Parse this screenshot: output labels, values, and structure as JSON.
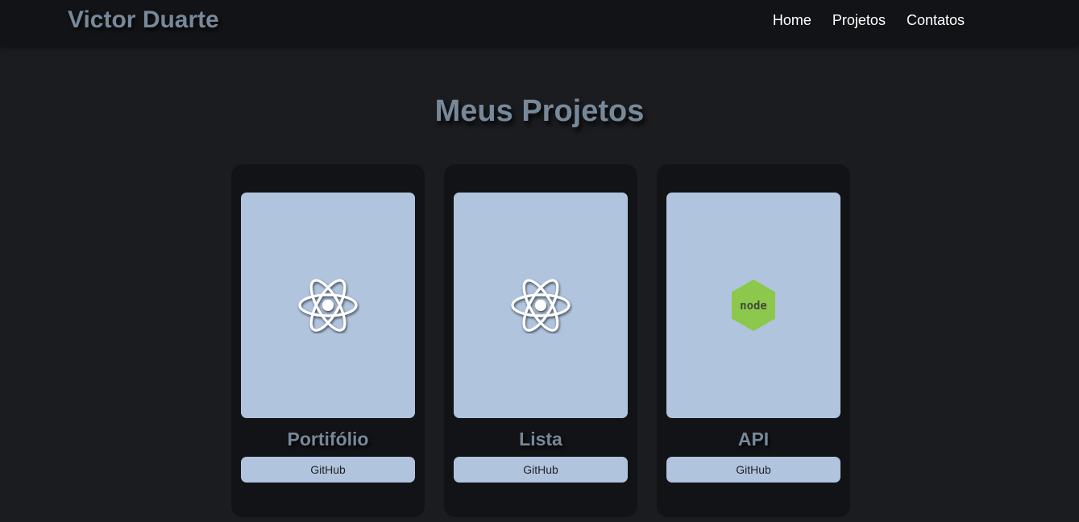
{
  "header": {
    "brand": "Victor Duarte",
    "nav": [
      "Home",
      "Projetos",
      "Contatos"
    ]
  },
  "main": {
    "title": "Meus Projetos",
    "projects": [
      {
        "title": "Portifólio",
        "icon": "react-icon",
        "button_label": "GitHub"
      },
      {
        "title": "Lista",
        "icon": "react-icon",
        "button_label": "GitHub"
      },
      {
        "title": "API",
        "icon": "nodejs-icon",
        "icon_text": "node",
        "button_label": "GitHub"
      }
    ]
  },
  "colors": {
    "background": "#1b1c20",
    "navbar": "#121316",
    "card": "#121316",
    "accent_text": "#778899",
    "card_image_bg": "#b0c4de",
    "node_green": "#8cc84b"
  }
}
